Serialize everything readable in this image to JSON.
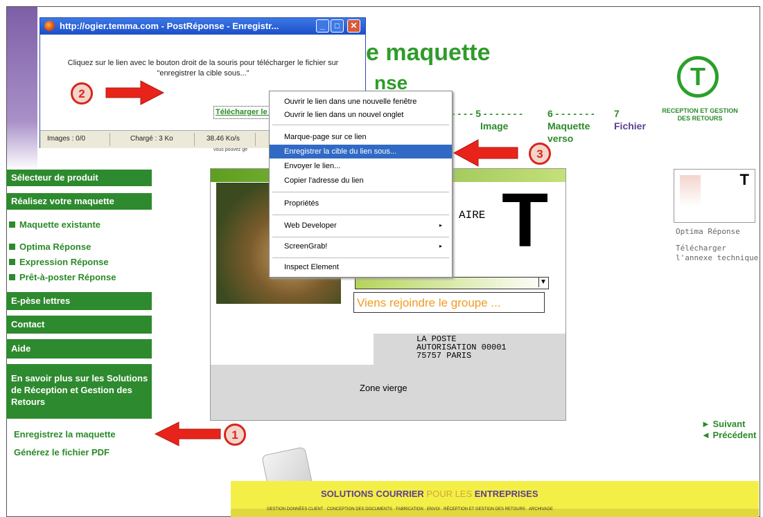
{
  "page": {
    "title_line1": "e maquette",
    "title_line2": "nse",
    "small_text": "vous pouvez gé",
    "steps": [
      {
        "num": "- - - -  5 - - - - - - -",
        "label": "Image"
      },
      {
        "num": "6 - - - - - - -",
        "label": "Maquette verso"
      },
      {
        "num": "7",
        "label": "Fichier"
      }
    ],
    "t_badge": "T",
    "t_caption": "RECEPTION ET GESTION DES RETOURS"
  },
  "sidebar": {
    "selecteur": "Sélecteur de produit",
    "realisez": "Réalisez votre maquette",
    "maquette_existante": "Maquette existante",
    "optima": "Optima Réponse",
    "expression": "Expression Réponse",
    "pret": "Prêt-à-poster Réponse",
    "epese": "E-pèse lettres",
    "contact": "Contact",
    "aide": "Aide",
    "en_savoir": "En savoir plus sur les Solutions de Réception et Gestion des Retours",
    "enregistrez": "Enregistrez la maquette",
    "generez": "Générez le fichier PDF"
  },
  "card": {
    "aire_text": "AIRE",
    "big_t": "T",
    "select_arrow": "▼",
    "orange_field": "Viens rejoindre le groupe ...",
    "la_poste": "LA POSTE\nAUTORISATION 00001\n75757 PARIS",
    "zone_vierge": "Zone vierge"
  },
  "right": {
    "thumb_t": "T",
    "optima_link": "Optima Réponse",
    "telecharger": "Télécharger\nl'annexe technique",
    "suivant": "► Suivant",
    "precedent": "◄ Précédent"
  },
  "popup": {
    "title": "http://ogier.temma.com - PostRéponse - Enregistr...",
    "message": "Cliquez sur le lien avec le bouton droit de la souris pour télécharger le fichier sur \"enregistrer la cible sous...\"",
    "link": "Télécharger le fichier",
    "status": {
      "images": "Images : 0/0",
      "charge": "Chargé : 3 Ko",
      "speed": "38.46 Ko/s"
    },
    "btn_min": "_",
    "btn_max": "□",
    "btn_close": "✕"
  },
  "context_menu": [
    {
      "label": "Ouvrir le lien dans une nouvelle fenêtre"
    },
    {
      "label": "Ouvrir le lien dans un nouvel onglet"
    },
    {
      "label": "Marque-page sur ce lien"
    },
    {
      "label": "Enregistrer la cible du lien sous..."
    },
    {
      "label": "Envoyer le lien..."
    },
    {
      "label": "Copier l'adresse du lien"
    },
    {
      "label": "Propriétés"
    },
    {
      "label": "Web Developer"
    },
    {
      "label": "ScreenGrab!"
    },
    {
      "label": "Inspect Element"
    }
  ],
  "submenu_arrow": "▸",
  "annotations": [
    "1",
    "2",
    "3"
  ],
  "footer": {
    "title_bold": "SOLUTIONS COURRIER",
    "title_plain": " POUR LES ",
    "title_end": "ENTREPRISES",
    "icons": "GESTION DONNÉES CLIENT · CONCEPTION DES DOCUMENTS · FABRICATION · ENVOI · RÉCEPTION ET GESTION DES RETOURS · ARCHIVAGE"
  },
  "colors": {
    "green": "#2e8a2e",
    "violet": "#5b3f8f",
    "red": "#d8251a",
    "highlight": "#316ac5"
  }
}
